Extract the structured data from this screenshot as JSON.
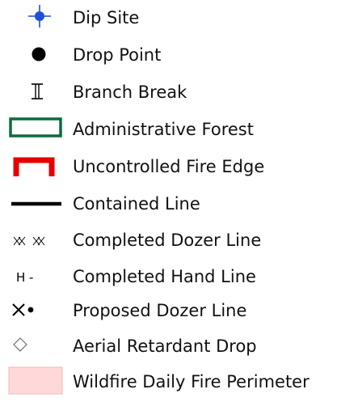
{
  "legend": {
    "items": [
      {
        "label": "Dip Site",
        "icon": "dip-site-icon",
        "color": "#1f4fd6"
      },
      {
        "label": "Drop Point",
        "icon": "drop-point-icon",
        "color": "#000000"
      },
      {
        "label": "Branch Break",
        "icon": "branch-break-icon",
        "color": "#000000"
      },
      {
        "label": "Administrative Forest",
        "icon": "administrative-forest-icon",
        "color": "#0d6b3e"
      },
      {
        "label": "Uncontrolled Fire Edge",
        "icon": "uncontrolled-fire-edge-icon",
        "color": "#e60000"
      },
      {
        "label": "Contained Line",
        "icon": "contained-line-icon",
        "color": "#000000"
      },
      {
        "label": "Completed Dozer Line",
        "icon": "completed-dozer-line-icon",
        "color": "#000000"
      },
      {
        "label": "Completed Hand Line",
        "icon": "completed-hand-line-icon",
        "color": "#000000"
      },
      {
        "label": "Proposed Dozer Line",
        "icon": "proposed-dozer-line-icon",
        "color": "#000000"
      },
      {
        "label": "Aerial Retardant Drop",
        "icon": "aerial-retardant-drop-icon",
        "color": "#6e6e6e"
      },
      {
        "label": "Wildfire Daily Fire Perimeter",
        "icon": "wildfire-daily-fire-perimeter-icon",
        "color": "#ffd9d9"
      }
    ]
  },
  "symbols": {
    "completed_hand_line_text": "H -"
  }
}
